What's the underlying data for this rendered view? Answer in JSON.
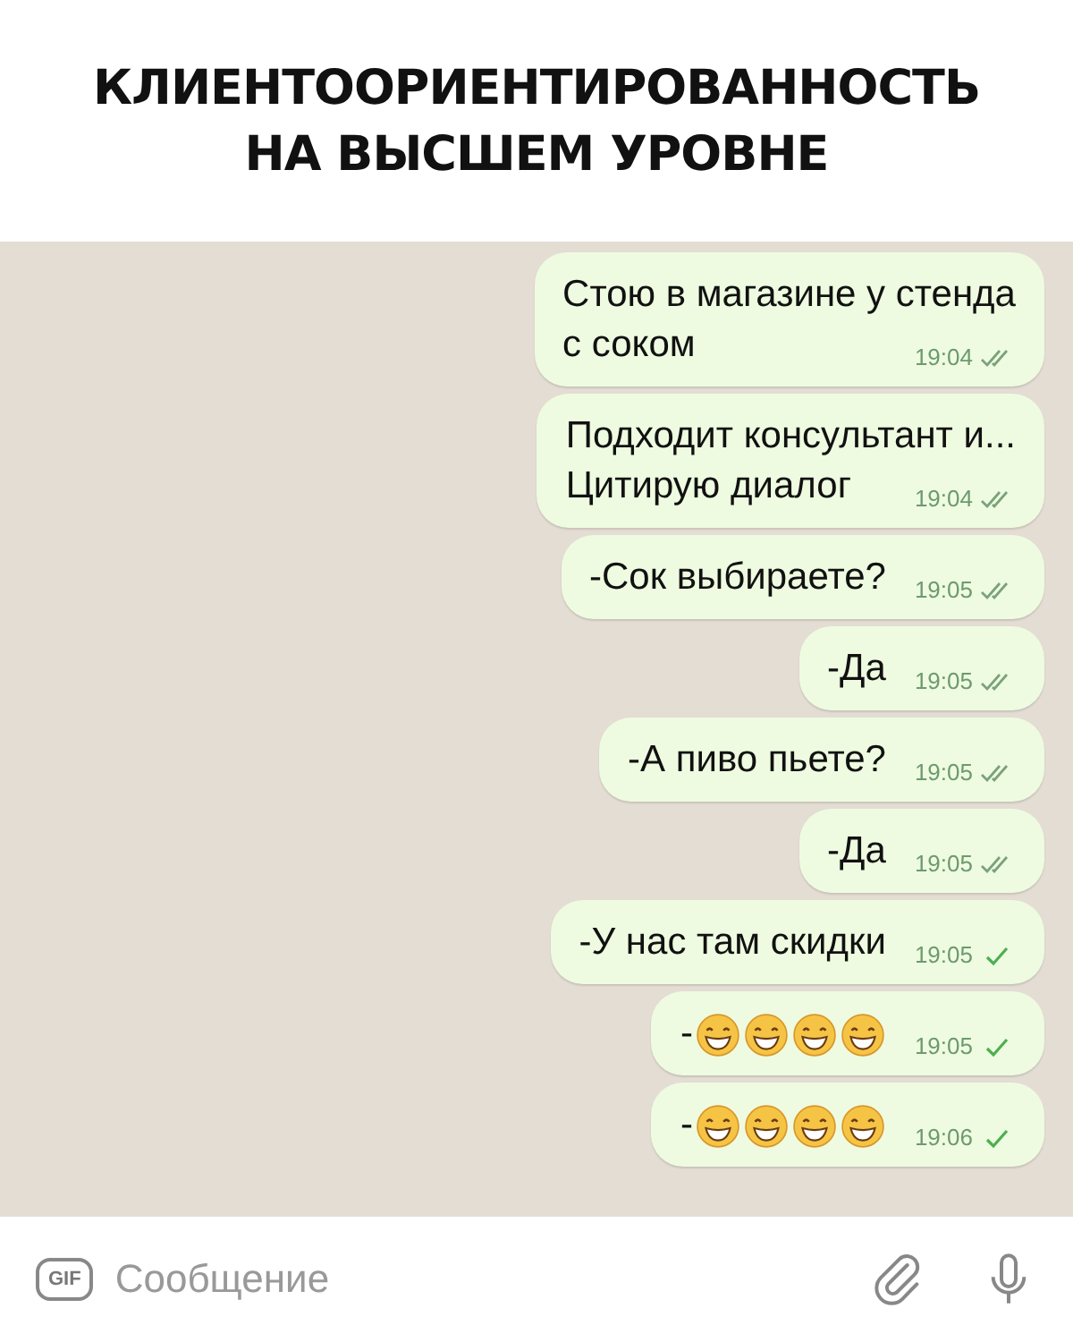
{
  "caption": [
    "КЛИЕНТООРИЕНТИРОВАННОСТЬ",
    "НА ВЫСШЕМ УРОВНЕ"
  ],
  "messages": [
    {
      "lines": [
        "Стою в магазине у стенда",
        "с соком"
      ],
      "time": "19:04",
      "read": true
    },
    {
      "lines": [
        "Подходит консультант и...",
        "Цитирую диалог"
      ],
      "time": "19:04",
      "read": true
    },
    {
      "lines": [
        "-Сок выбираете?"
      ],
      "time": "19:05",
      "read": true
    },
    {
      "lines": [
        "-Да"
      ],
      "time": "19:05",
      "read": true
    },
    {
      "lines": [
        "-А пиво пьете?"
      ],
      "time": "19:05",
      "read": true
    },
    {
      "lines": [
        "-Да"
      ],
      "time": "19:05",
      "read": true
    },
    {
      "lines": [
        "-У нас там скидки"
      ],
      "time": "19:05",
      "read": false
    },
    {
      "lines": [
        "-"
      ],
      "emoji": [
        {
          "kind": "grin"
        },
        {
          "kind": "grin"
        },
        {
          "kind": "grin"
        },
        {
          "kind": "grin"
        }
      ],
      "time": "19:05",
      "read": false
    },
    {
      "lines": [
        "-"
      ],
      "emoji": [
        {
          "kind": "grin"
        },
        {
          "kind": "grin"
        },
        {
          "kind": "grin"
        },
        {
          "kind": "grin"
        }
      ],
      "time": "19:06",
      "read": false
    }
  ],
  "composer": {
    "gif_label": "GIF",
    "placeholder": "Сообщение"
  }
}
